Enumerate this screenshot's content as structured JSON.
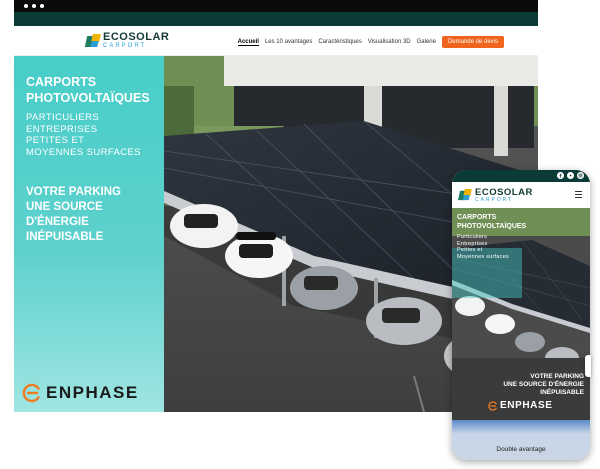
{
  "browser": {
    "dots": [
      "•",
      "•",
      "•"
    ]
  },
  "brand": {
    "name": "ECOSOLAR",
    "tagline": "CARPORT"
  },
  "desktop": {
    "nav": {
      "items": [
        "Accueil",
        "Les 10 avantages",
        "Caractéristiques",
        "Visualisation 3D",
        "Galerie"
      ],
      "active": "Accueil",
      "cta": "Demande de devis"
    },
    "hero": {
      "title_line1": "CARPORTS",
      "title_line2": "PHOTOVOLTAÏQUES",
      "sub": [
        "PARTICULIERS",
        "ENTREPRISES",
        "PETITES ET",
        "MOYENNES SURFACES"
      ],
      "slogan_line1": "VOTRE PARKING",
      "slogan_line2": "UNE SOURCE D'ÉNERGIE",
      "slogan_line3": "INÉPUISABLE",
      "partner": "ENPHASE"
    }
  },
  "mobile": {
    "hero": {
      "title_line1": "CARPORTS",
      "title_line2": "PHOTOVOLTAÏQUES",
      "sub": [
        "Particuliers",
        "Entreprises",
        "Petites et",
        "Moyennes surfaces"
      ],
      "slogan_line1": "VOTRE PARKING",
      "slogan_line2": "UNE SOURCE D'ÉNERGIE",
      "slogan_line3": "INÉPUISABLE",
      "partner": "ENPHASE"
    },
    "next_section": "Double avantage"
  },
  "colors": {
    "dark_teal": "#0b3b36",
    "hero_teal": "#48cdc8",
    "cta_orange": "#f0641e",
    "enphase_orange": "#f07a20"
  },
  "icons": {
    "social": [
      "facebook-icon",
      "youtube-icon",
      "instagram-icon"
    ],
    "menu": "hamburger-menu-icon"
  }
}
